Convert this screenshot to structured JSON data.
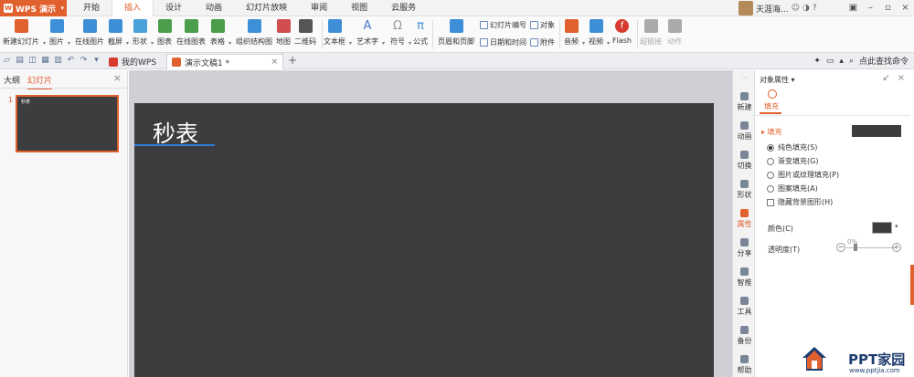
{
  "app": {
    "name": "WPS 演示",
    "logo_char": "W"
  },
  "menu_tabs": [
    "开始",
    "插入",
    "设计",
    "动画",
    "幻灯片放映",
    "审阅",
    "视图",
    "云服务"
  ],
  "active_menu_tab_index": 1,
  "user": {
    "name": "天涯海..."
  },
  "ribbon": {
    "buttons": [
      {
        "label": "新建幻灯片",
        "icon": "new-slide-icon",
        "color": "#e0602e"
      },
      {
        "label": "图片",
        "icon": "picture-icon",
        "color": "#3e8fd8"
      },
      {
        "label": "在线图片",
        "icon": "online-picture-icon",
        "color": "#3e8fd8"
      },
      {
        "label": "截屏",
        "icon": "screenshot-icon",
        "color": "#3e8fd8"
      },
      {
        "label": "形状",
        "icon": "shape-icon",
        "color": "#4aa0d8"
      },
      {
        "label": "图表",
        "icon": "chart-icon",
        "color": "#4c9e4c"
      },
      {
        "label": "在线图表",
        "icon": "online-chart-icon",
        "color": "#4c9e4c"
      },
      {
        "label": "表格",
        "icon": "table-icon",
        "color": "#4c9e4c"
      },
      {
        "label": "组织结构图",
        "icon": "org-chart-icon",
        "color": "#3e8fd8"
      },
      {
        "label": "地图",
        "icon": "map-icon",
        "color": "#d04e4e"
      },
      {
        "label": "二维码",
        "icon": "qrcode-icon",
        "color": "#555555"
      },
      {
        "label": "文本框",
        "icon": "textbox-icon",
        "color": "#3e8fd8"
      },
      {
        "label": "艺术字",
        "icon": "wordart-icon",
        "color": "#4a79c8"
      },
      {
        "label": "符号",
        "icon": "symbol-icon",
        "color": "#999999"
      },
      {
        "label": "公式",
        "icon": "formula-icon",
        "color": "#3e8fd8"
      },
      {
        "label": "页眉和页脚",
        "icon": "header-footer-icon",
        "color": "#3e8fd8"
      },
      {
        "label": "音频",
        "icon": "audio-icon",
        "color": "#e0602e"
      },
      {
        "label": "视频",
        "icon": "video-icon",
        "color": "#3e8fd8"
      },
      {
        "label": "Flash",
        "icon": "flash-icon",
        "color": "#d73a2e"
      },
      {
        "label": "超链接",
        "icon": "hyperlink-icon",
        "color": "#aaaaaa"
      },
      {
        "label": "动作",
        "icon": "action-icon",
        "color": "#aaaaaa"
      }
    ],
    "small": {
      "slide_number": "幻灯片编号",
      "object": "对象",
      "datetime": "日期和时间",
      "attachment": "附件"
    },
    "glyphs": {
      "symbol": "Ω",
      "formula": "π",
      "wordart": "A",
      "flash": "f"
    }
  },
  "tabs_bar": {
    "wps_tab": "我的WPS",
    "doc_tab": "演示文稿1 *",
    "close_glyph": "×",
    "new_glyph": "+",
    "search_hint": "点此查找命令"
  },
  "left_panel": {
    "tabs": [
      "大纲",
      "幻灯片"
    ],
    "active_tab": 1,
    "slide_number": "1",
    "thumb_title": "秒表"
  },
  "slide": {
    "title": "秒表",
    "bg_color": "#3d3d3f",
    "underline_color": "#2c7fd8"
  },
  "side_strip": [
    "新建",
    "动画",
    "切换",
    "形状",
    "属性",
    "分享",
    "智推",
    "工具",
    "备份",
    "帮助"
  ],
  "active_side_index": 4,
  "pane": {
    "title": "对象属性 ▾",
    "tab": "填充",
    "fill_header": "▸ 填充",
    "options": [
      {
        "label": "纯色填充(S)",
        "checked": true
      },
      {
        "label": "渐变填充(G)",
        "checked": false
      },
      {
        "label": "图片或纹理填充(P)",
        "checked": false
      },
      {
        "label": "图案填充(A)",
        "checked": false
      }
    ],
    "hide_bg": "隐藏背景图形(H)",
    "color_label": "颜色(C)",
    "transparency_label": "透明度(T)",
    "transparency_value": "0%",
    "transparency_fraction": 0,
    "fill_color": "#3d3d3f"
  },
  "watermark": {
    "text": "PPT家园",
    "url": "www.pptjia.com"
  },
  "accent_color": "#e0602e"
}
